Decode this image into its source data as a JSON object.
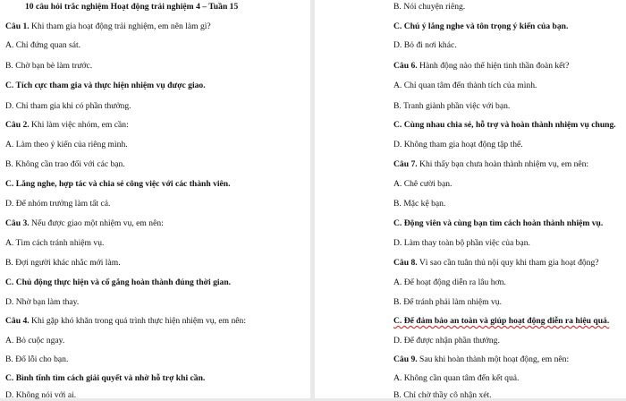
{
  "title": "10 câu hỏi trắc nghiệm Hoạt động trải nghiệm 4 – Tuần 15",
  "left": {
    "q1": {
      "label": "Câu 1.",
      "text": " Khi tham gia hoạt động trải nghiệm, em nên làm gì?"
    },
    "q1_a": "A. Chỉ đứng quan sát.",
    "q1_b": "B. Chờ bạn bè làm trước.",
    "q1_c": "C. Tích cực tham gia và thực hiện nhiệm vụ được giao.",
    "q1_d": "D. Chỉ tham gia khi có phần thưởng.",
    "q2": {
      "label": "Câu 2.",
      "text": " Khi làm việc nhóm, em cần:"
    },
    "q2_a": "A. Làm theo ý kiến của riêng mình.",
    "q2_b": "B. Không cần trao đổi với các bạn.",
    "q2_c": "C. Lắng nghe, hợp tác và chia sẻ công việc với các thành viên.",
    "q2_d": "D. Để nhóm trưởng làm tất cả.",
    "q3": {
      "label": "Câu 3.",
      "text": " Nếu được giao một nhiệm vụ, em nên:"
    },
    "q3_a": "A. Tìm cách tránh nhiệm vụ.",
    "q3_b": "B. Đợi người khác nhắc mới làm.",
    "q3_c": "C. Chủ động thực hiện và cố gắng hoàn thành đúng thời gian.",
    "q3_d": "D. Nhờ bạn làm thay.",
    "q4": {
      "label": "Câu 4.",
      "text": " Khi gặp khó khăn trong quá trình thực hiện nhiệm vụ, em nên:"
    },
    "q4_a": "A. Bỏ cuộc ngay.",
    "q4_b": "B. Đổ lỗi cho bạn.",
    "q4_c": "C. Bình tĩnh tìm cách giải quyết và nhờ hỗ trợ khi cần.",
    "q4_d": "D. Không nói với ai."
  },
  "right": {
    "q5_b": "B. Nói chuyện riêng.",
    "q5_c": "C. Chú ý lắng nghe và tôn trọng ý kiến của bạn.",
    "q5_d": "D. Bỏ đi nơi khác.",
    "q6": {
      "label": "Câu 6.",
      "text": " Hành động nào thể hiện tinh thần đoàn kết?"
    },
    "q6_a": "A. Chỉ quan tâm đến thành tích của mình.",
    "q6_b": "B. Tranh giành phần việc với bạn.",
    "q6_c": "C. Cùng nhau chia sẻ, hỗ trợ và hoàn thành nhiệm vụ chung.",
    "q6_d": "D. Không tham gia hoạt động tập thể.",
    "q7": {
      "label": "Câu 7.",
      "text": " Khi thấy bạn chưa hoàn thành nhiệm vụ, em nên:"
    },
    "q7_a": "A. Chê cười bạn.",
    "q7_b": "B. Mặc kệ bạn.",
    "q7_c": "C. Động viên và cùng bạn tìm cách hoàn thành nhiệm vụ.",
    "q7_d": "D. Làm thay toàn bộ phần việc của bạn.",
    "q8": {
      "label": "Câu 8.",
      "text": " Vì sao cần tuân thủ nội quy khi tham gia hoạt động?"
    },
    "q8_a": "A. Để hoạt động diễn ra lâu hơn.",
    "q8_b": "B. Để tránh phải làm nhiệm vụ.",
    "q8_c": "C. Để đảm bảo an toàn và giúp hoạt động diễn ra hiệu quả.",
    "q8_d": "D. Để được nhận phần thưởng.",
    "q9": {
      "label": "Câu 9.",
      "text": " Sau khi hoàn thành một hoạt động, em nên:"
    },
    "q9_a": "A. Không cần quan tâm đến kết quả.",
    "q9_b": "B. Chỉ chờ thầy cô nhận xét."
  }
}
